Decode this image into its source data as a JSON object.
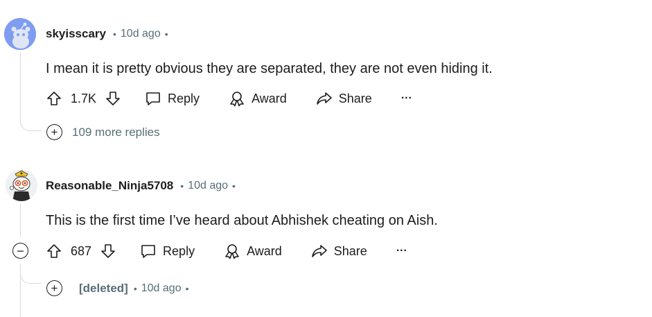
{
  "comments": [
    {
      "username": "skyisscary",
      "time": "10d ago",
      "separator": "•",
      "text": "I mean it is pretty obvious they are separated, they are not even hiding it.",
      "votes": "1.7K",
      "reply_label": "Reply",
      "award_label": "Award",
      "share_label": "Share",
      "more_label": "···",
      "more_replies": "109 more replies",
      "avatar_icon": "snoo-avatar-icon"
    },
    {
      "username": "Reasonable_Ninja5708",
      "time": "10d ago",
      "separator": "•",
      "text": "This is the first time I’ve heard about Abhishek cheating on Aish.",
      "votes": "687",
      "reply_label": "Reply",
      "award_label": "Award",
      "share_label": "Share",
      "more_label": "···",
      "avatar_icon": "snoo-avatar-icon"
    }
  ],
  "deleted_reply": {
    "username": "[deleted]",
    "time": "10d ago",
    "separator": "•"
  },
  "colors": {
    "text": "#1c1c1c",
    "meta": "#576f76",
    "thread_line": "#d6d9db",
    "avatar1_bg": "#7e9cf0"
  }
}
